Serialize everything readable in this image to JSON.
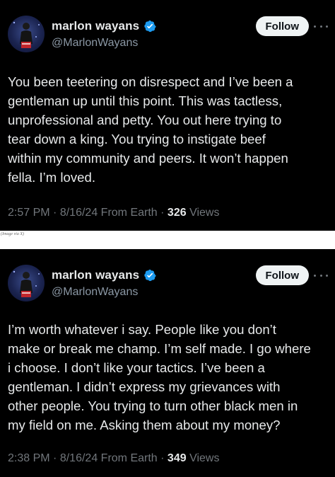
{
  "tweets": [
    {
      "display_name": "marlon wayans",
      "handle": "@MarlonWayans",
      "follow_label": "Follow",
      "text": "You been teetering on disrespect and I’ve been a\ngentleman up until this point. This was tactless,\nunprofessional and petty. You out here trying to\ntear down a king.  You trying to instigate beef\nwithin my community and peers. It won’t happen\nfella. I’m loved.",
      "time": "2:57 PM",
      "date": "8/16/24",
      "source": "From Earth",
      "views": "326",
      "views_label": "Views"
    },
    {
      "display_name": "marlon wayans",
      "handle": "@MarlonWayans",
      "follow_label": "Follow",
      "text": "I’m worth whatever i say. People like you don’t\nmake or break me champ. I’m self made. I go where\ni choose. I don’t like your tactics. I’ve been a\ngentleman. I didn’t express my grievances with\nother people. You trying to turn other black men in\nmy field on me. Asking them about my money?",
      "time": "2:38 PM",
      "date": "8/16/24",
      "source": "From Earth",
      "views": "349",
      "views_label": "Views"
    }
  ],
  "caption": "(Image via X)",
  "colors": {
    "background": "#000000",
    "text": "#e7e9ea",
    "muted": "#71767b",
    "verified_badge": "#1d9bf0",
    "follow_button_bg": "#eff3f4"
  },
  "icons": [
    "verified-badge-icon",
    "more-options-icon"
  ]
}
